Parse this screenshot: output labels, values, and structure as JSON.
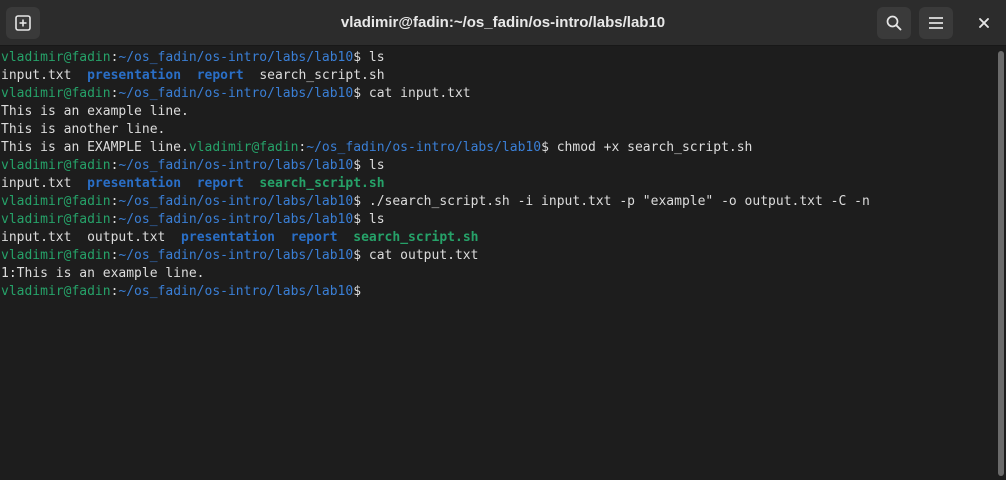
{
  "window": {
    "title": "vladimir@fadin:~/os_fadin/os-intro/labs/lab10"
  },
  "icons": {
    "new_tab": "new-tab-icon",
    "search": "search-icon",
    "menu": "hamburger-menu-icon",
    "close": "close-icon"
  },
  "colors": {
    "prompt_user": "#26a269",
    "prompt_path": "#3a7fd6",
    "directory": "#2a6fc7",
    "executable": "#26a269",
    "text": "#dcdcdc",
    "background": "#1d1d1d"
  },
  "terminal": {
    "prompt_user": "vladimir@fadin",
    "prompt_sep": ":",
    "prompt_path": "~/os_fadin/os-intro/labs/lab10",
    "prompt_end": "$ ",
    "lines": {
      "l1_cmd": "ls",
      "l2": {
        "f1": "input.txt",
        "gap1": "  ",
        "d1": "presentation",
        "gap2": "  ",
        "d2": "report",
        "gap3": "  ",
        "f2": "search_script.sh"
      },
      "l3_cmd": "cat input.txt",
      "l4": "This is an example line.",
      "l5": "This is another line.",
      "l6_text": "This is an EXAMPLE line.",
      "l6_cmd": "chmod +x search_script.sh",
      "l7_cmd": "ls",
      "l8": {
        "f1": "input.txt",
        "gap1": "  ",
        "d1": "presentation",
        "gap2": "  ",
        "d2": "report",
        "gap3": "  ",
        "x1": "search_script.sh"
      },
      "l9_cmd": "./search_script.sh -i input.txt -p \"example\" -o output.txt -C -n",
      "l10_cmd": "ls",
      "l11": {
        "f1": "input.txt",
        "gap1": "  ",
        "f2": "output.txt",
        "gap2": "  ",
        "d1": "presentation",
        "gap3": "  ",
        "d2": "report",
        "gap4": "  ",
        "x1": "search_script.sh"
      },
      "l12_cmd": "cat output.txt",
      "l13": "1:This is an example line.",
      "l14_cmd": ""
    }
  }
}
